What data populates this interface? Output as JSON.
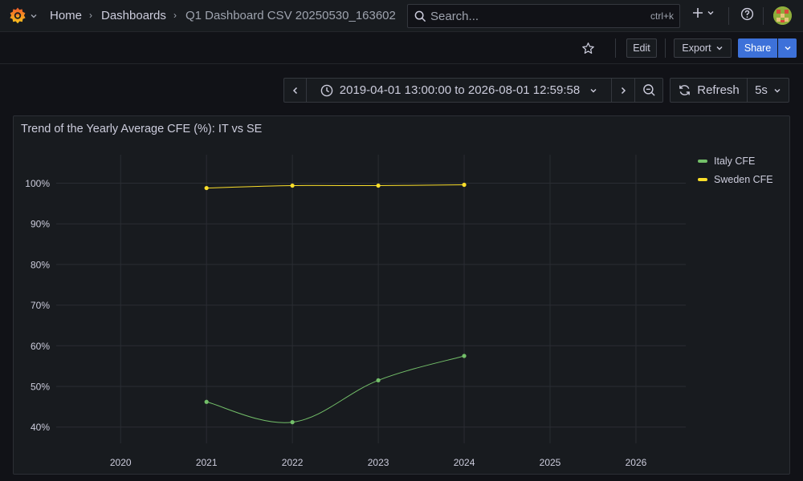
{
  "nav": {
    "breadcrumbs": [
      "Home",
      "Dashboards",
      "Q1 Dashboard CSV 20250530_163602"
    ],
    "search_placeholder": "Search...",
    "search_shortcut": "ctrl+k"
  },
  "toolbar": {
    "edit_label": "Edit",
    "export_label": "Export",
    "share_label": "Share"
  },
  "time_controls": {
    "range": "2019-04-01 13:00:00 to 2026-08-01 12:59:58",
    "refresh_label": "Refresh",
    "refresh_interval": "5s"
  },
  "colors": {
    "italy": "#73bf69",
    "sweden": "#fade2a",
    "primary": "#3d71d9"
  },
  "icons": [
    "grafana-logo-icon",
    "search-icon",
    "plus-icon",
    "help-icon",
    "star-icon",
    "clock-icon",
    "zoom-out-icon",
    "refresh-icon",
    "chevron-left-icon",
    "chevron-right-icon",
    "chevron-down-icon"
  ],
  "panel": {
    "title": "Trend of the Yearly Average CFE (%): IT vs SE"
  },
  "chart_data": {
    "type": "line",
    "title": "Trend of the Yearly Average CFE (%): IT vs SE",
    "x_ticks": [
      "2020",
      "2021",
      "2022",
      "2023",
      "2024",
      "2025",
      "2026"
    ],
    "y_ticks": [
      "40%",
      "50%",
      "60%",
      "70%",
      "80%",
      "90%",
      "100%"
    ],
    "xlim": [
      2019.25,
      2026.58
    ],
    "ylim": [
      36,
      107
    ],
    "grid": true,
    "legend_position": "right",
    "series": [
      {
        "name": "Italy CFE",
        "color": "#73bf69",
        "x": [
          2021,
          2022,
          2023,
          2024
        ],
        "values": [
          46.2,
          41.2,
          51.5,
          57.5
        ]
      },
      {
        "name": "Sweden CFE",
        "color": "#fade2a",
        "x": [
          2021,
          2022,
          2023,
          2024
        ],
        "values": [
          98.8,
          99.4,
          99.4,
          99.6
        ]
      }
    ]
  }
}
